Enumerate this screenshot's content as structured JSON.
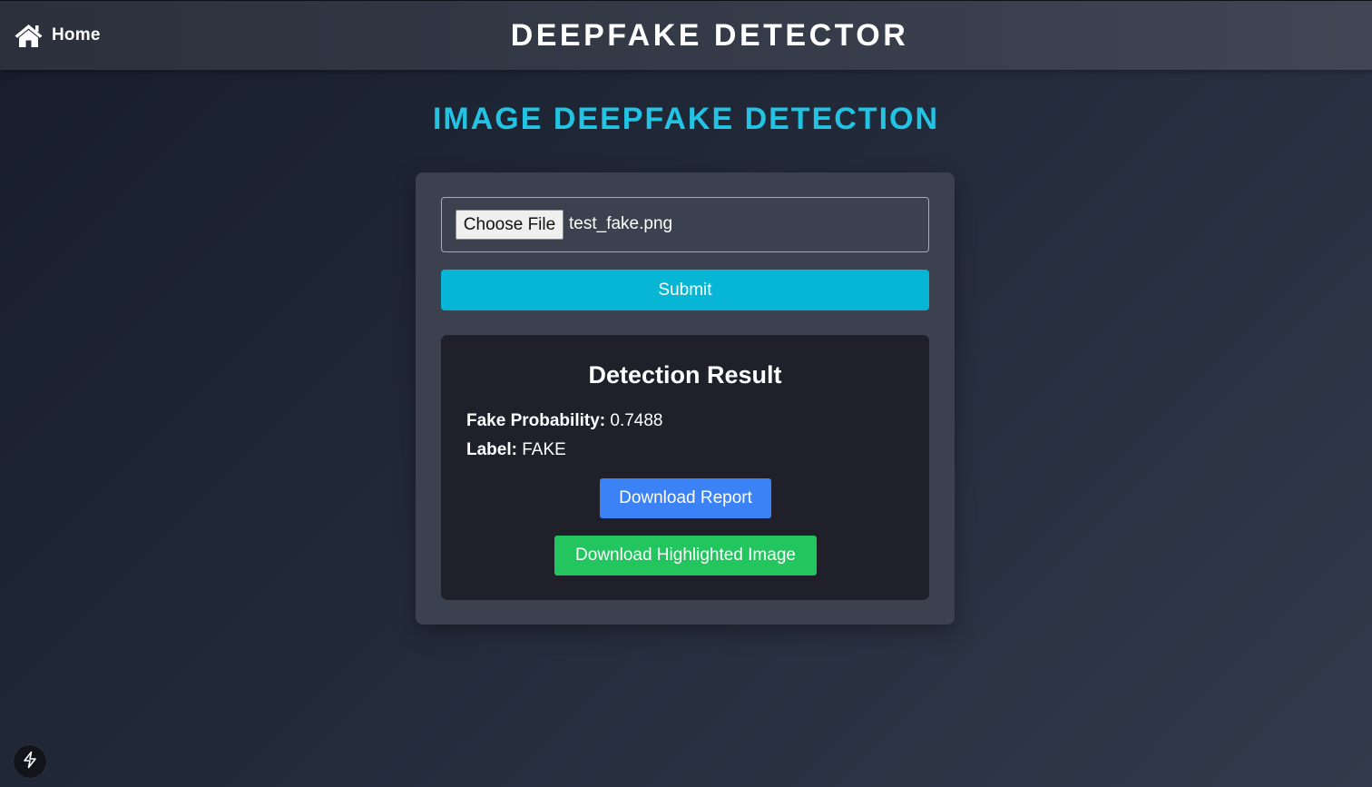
{
  "header": {
    "home_label": "Home",
    "home_icon": "home-icon",
    "app_title": "DEEPFAKE DETECTOR"
  },
  "main": {
    "heading": "IMAGE DEEPFAKE DETECTION",
    "file_input": {
      "button_label": "Choose File",
      "selected_file": "test_fake.png"
    },
    "submit_label": "Submit",
    "result": {
      "title": "Detection Result",
      "probability_key": "Fake Probability:",
      "probability_value": "0.7488",
      "label_key": "Label:",
      "label_value": "FAKE",
      "download_report_label": "Download Report",
      "download_image_label": "Download Highlighted Image"
    }
  },
  "footer": {
    "badge_icon": "bolt-icon"
  },
  "colors": {
    "accent_heading": "#22c3e3",
    "submit_button": "#06b6d4",
    "download_report_button": "#3b82f6",
    "download_image_button": "#22c55e"
  }
}
